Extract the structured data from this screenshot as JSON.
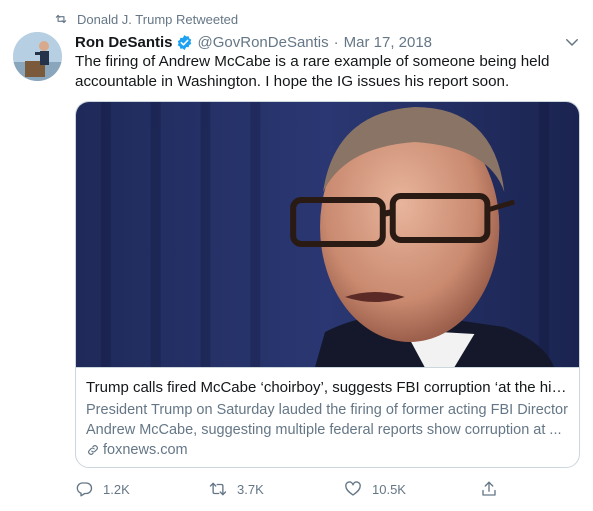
{
  "retweet_notice": {
    "icon": "retweet-icon",
    "text": "Donald J. Trump Retweeted"
  },
  "tweet": {
    "author_name": "Ron DeSantis",
    "verified_icon": "verified-badge-icon",
    "handle": "@GovRonDeSantis",
    "separator": "·",
    "date": "Mar 17, 2018",
    "menu_icon": "chevron-down-icon",
    "text": "The firing of Andrew McCabe is a rare example of someone being held accountable in Washington.  I hope the IG issues his report soon."
  },
  "card": {
    "image_icon": "news-photo",
    "title": "Trump calls fired McCabe ‘choirboy’, suggests FBI corruption ‘at the highe...",
    "description": "President Trump on Saturday lauded the firing of former acting FBI Director Andrew McCabe, suggesting multiple federal reports show corruption at ...",
    "domain": "foxnews.com",
    "domain_icon": "link-icon"
  },
  "actions": {
    "reply_count": "1.2K",
    "retweet_count": "3.7K",
    "like_count": "10.5K",
    "share_icon": "share-icon"
  },
  "colors": {
    "accent": "#1da1f2",
    "secondary_text": "#657786",
    "border": "#ccd6dd"
  }
}
